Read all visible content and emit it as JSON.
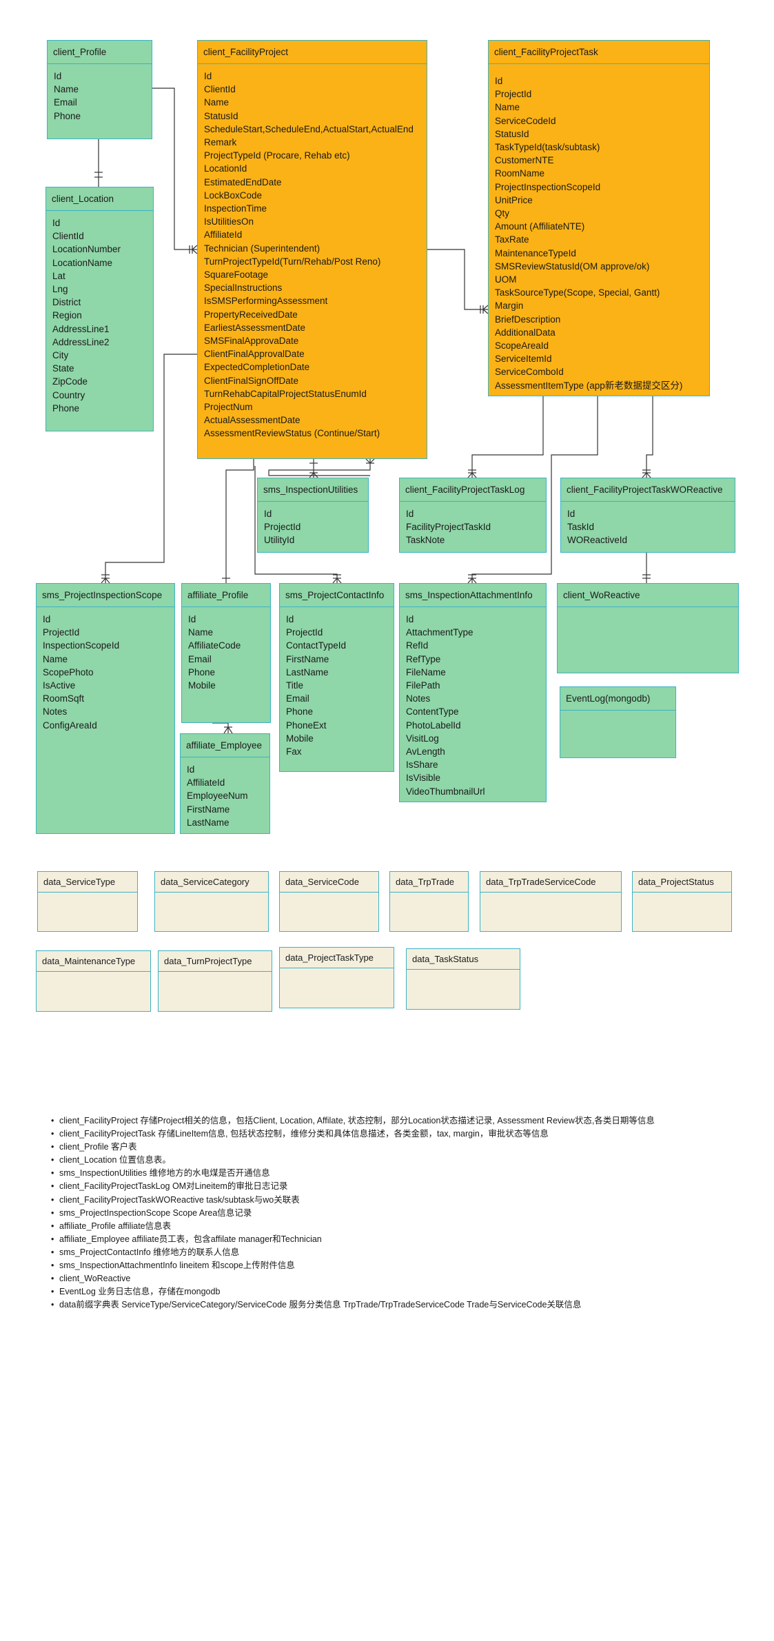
{
  "entities": {
    "client_profile": {
      "title": "client_Profile",
      "fields": [
        "Id",
        "Name",
        "Email",
        "Phone"
      ]
    },
    "client_location": {
      "title": "client_Location",
      "fields": [
        "Id",
        "ClientId",
        "LocationNumber",
        "LocationName",
        "Lat",
        "Lng",
        "District",
        "Region",
        "AddressLine1",
        "AddressLine2",
        "City",
        "State",
        "ZipCode",
        "Country",
        "Phone"
      ]
    },
    "client_facility_project": {
      "title": "client_FacilityProject",
      "fields": [
        "Id",
        "ClientId",
        "Name",
        "StatusId",
        "ScheduleStart,ScheduleEnd,ActualStart,ActualEnd",
        "Remark",
        "ProjectTypeId (Procare, Rehab etc)",
        "LocationId",
        "EstimatedEndDate",
        "LockBoxCode",
        "InspectionTime",
        "IsUtilitiesOn",
        "AffiliateId",
        "Technician (Superintendent)",
        "TurnProjectTypeId(Turn/Rehab/Post Reno)",
        "SquareFootage",
        "SpecialInstructions",
        "IsSMSPerformingAssessment",
        "PropertyReceivedDate",
        "EarliestAssessmentDate",
        "SMSFinalApprovaDate",
        "ClientFinalApprovalDate",
        "ExpectedCompletionDate",
        "ClientFinalSignOffDate",
        "TurnRehabCapitalProjectStatusEnumId",
        "ProjectNum",
        "ActualAssessmentDate",
        "AssessmentReviewStatus (Continue/Start)"
      ]
    },
    "client_facility_project_task": {
      "title": "client_FacilityProjectTask",
      "fields": [
        "Id",
        "ProjectId",
        "Name",
        "ServiceCodeId",
        "StatusId",
        "TaskTypeId(task/subtask)",
        "CustomerNTE",
        "RoomName",
        "ProjectInspectionScopeId",
        "UnitPrice",
        "Qty",
        "Amount (AffiliateNTE)",
        "TaxRate",
        "MaintenanceTypeId",
        "SMSReviewStatusId(OM approve/ok)",
        "UOM",
        "TaskSourceType(Scope, Special, Gantt)",
        "Margin",
        "BriefDescription",
        "AdditionalData",
        "ScopeAreaId",
        "ServiceItemId",
        "ServiceComboId",
        "AssessmentItemType (app新老数据提交区分)"
      ]
    },
    "sms_inspection_utilities": {
      "title": "sms_InspectionUtilities",
      "fields": [
        "Id",
        "ProjectId",
        "UtilityId"
      ]
    },
    "client_facility_project_task_log": {
      "title": "client_FacilityProjectTaskLog",
      "fields": [
        "Id",
        "FacilityProjectTaskId",
        "TaskNote"
      ]
    },
    "client_facility_project_task_wo_reactive": {
      "title": "client_FacilityProjectTaskWOReactive",
      "fields": [
        "Id",
        "TaskId",
        "WOReactiveId"
      ]
    },
    "sms_project_inspection_scope": {
      "title": "sms_ProjectInspectionScope",
      "fields": [
        "Id",
        "ProjectId",
        "InspectionScopeId",
        "Name",
        "ScopePhoto",
        "IsActive",
        "RoomSqft",
        "Notes",
        "ConfigAreaId"
      ]
    },
    "affiliate_profile": {
      "title": "affiliate_Profile",
      "fields": [
        "Id",
        "Name",
        "AffiliateCode",
        "Email",
        "Phone",
        "Mobile"
      ]
    },
    "affiliate_employee": {
      "title": "affiliate_Employee",
      "fields": [
        "Id",
        "AffiliateId",
        "EmployeeNum",
        "FirstName",
        "LastName"
      ]
    },
    "sms_project_contact_info": {
      "title": "sms_ProjectContactInfo",
      "fields": [
        "Id",
        "ProjectId",
        "ContactTypeId",
        "FirstName",
        "LastName",
        "Title",
        "Email",
        "Phone",
        "PhoneExt",
        "Mobile",
        "Fax"
      ]
    },
    "sms_inspection_attachment_info": {
      "title": "sms_InspectionAttachmentInfo",
      "fields": [
        "Id",
        "AttachmentType",
        "RefId",
        "RefType",
        "FileName",
        "FilePath",
        "Notes",
        "ContentType",
        "PhotoLabelId",
        "VisitLog",
        "AvLength",
        "IsShare",
        "IsVisible",
        "VideoThumbnailUrl"
      ]
    },
    "client_wo_reactive": {
      "title": "client_WoReactive",
      "fields": []
    },
    "event_log": {
      "title": "EventLog(mongodb)",
      "fields": []
    },
    "data_service_type": {
      "title": "data_ServiceType",
      "fields": []
    },
    "data_service_category": {
      "title": "data_ServiceCategory",
      "fields": []
    },
    "data_service_code": {
      "title": "data_ServiceCode",
      "fields": []
    },
    "data_trp_trade": {
      "title": "data_TrpTrade",
      "fields": []
    },
    "data_trp_trade_service_code": {
      "title": "data_TrpTradeServiceCode",
      "fields": []
    },
    "data_project_status": {
      "title": "data_ProjectStatus",
      "fields": []
    },
    "data_maintenance_type": {
      "title": "data_MaintenanceType",
      "fields": []
    },
    "data_turn_project_type": {
      "title": "data_TurnProjectType",
      "fields": []
    },
    "data_project_task_type": {
      "title": "data_ProjectTaskType",
      "fields": []
    },
    "data_task_status": {
      "title": "data_TaskStatus",
      "fields": []
    }
  },
  "notes": [
    "client_FacilityProject    存储Project相关的信息，包括Client, Location, Affilate, 状态控制，部分Location状态描述记录, Assessment Review状态,各类日期等信息",
    "client_FacilityProjectTask 存储LineItem信息, 包括状态控制，维修分类和具体信息描述，各类金额，tax, margin，审批状态等信息",
    "client_Profile    客户表",
    "client_Location   位置信息表。",
    "sms_InspectionUtilities   维修地方的水电煤是否开通信息",
    "client_FacilityProjectTaskLog    OM对Lineitem的审批日志记录",
    "client_FacilityProjectTaskWOReactive   task/subtask与wo关联表",
    "sms_ProjectInspectionScope   Scope Area信息记录",
    "affiliate_Profile        affiliate信息表",
    "affiliate_Employee    affiliate员工表，包含affilate manager和Technician",
    "sms_ProjectContactInfo   维修地方的联系人信息",
    "sms_InspectionAttachmentInfo    lineitem 和scope上传附件信息",
    "client_WoReactive",
    "EventLog         业务日志信息，存储在mongodb",
    "data前缀字典表    ServiceType/ServiceCategory/ServiceCode 服务分类信息       TrpTrade/TrpTradeServiceCode    Trade与ServiceCode关联信息"
  ],
  "style": {
    "green": "#8fd6a8",
    "orange": "#fbb216",
    "beige": "#f4efdd",
    "border": "#3bb3c3",
    "line": "#333333"
  }
}
